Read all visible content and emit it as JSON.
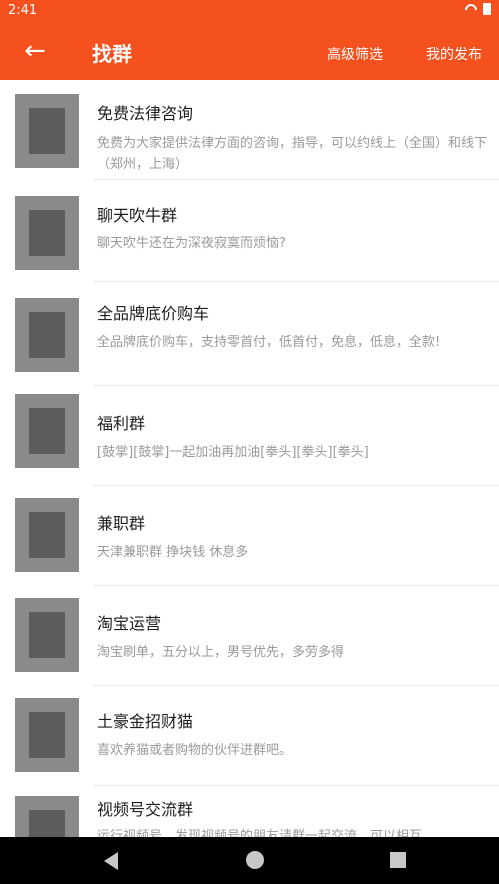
{
  "status": {
    "time": "2:41"
  },
  "appbar": {
    "title": "找群",
    "filter_label": "高级筛选",
    "mypub_label": "我的发布"
  },
  "icons": {
    "back": "arrow-left-icon",
    "wifi": "wifi-icon",
    "battery": "battery-icon",
    "nav_back": "triangle-back-icon",
    "nav_home": "circle-home-icon",
    "nav_recent": "square-recents-icon"
  },
  "items": [
    {
      "title": "免费法律咨询",
      "desc": "免费为大家提供法律方面的咨询，指导，可以约线上（全国）和线下（郑州，上海）"
    },
    {
      "title": "聊天吹牛群",
      "desc": "聊天吹牛还在为深夜寂寞而烦恼?"
    },
    {
      "title": "全品牌底价购车",
      "desc": "全品牌底价购车，支持零首付，低首付，免息，低息，全款!"
    },
    {
      "title": "福利群",
      "desc": "[鼓掌][鼓掌]一起加油再加油[拳头][拳头][拳头]"
    },
    {
      "title": "兼职群",
      "desc": "天津兼职群 挣块钱 休息多"
    },
    {
      "title": "淘宝运营",
      "desc": "淘宝刷单，五分以上，男号优先，多劳多得"
    },
    {
      "title": "土豪金招财猫",
      "desc": "喜欢养猫或者购物的伙伴进群吧。"
    },
    {
      "title": "视频号交流群",
      "desc": "运行视频号，发现视频号的朋友请群一起交流，可以相互"
    }
  ],
  "colors": {
    "accent": "#f4511e",
    "title_text": "#202020",
    "desc_text": "#9a9a9a",
    "nav": "#000000"
  }
}
